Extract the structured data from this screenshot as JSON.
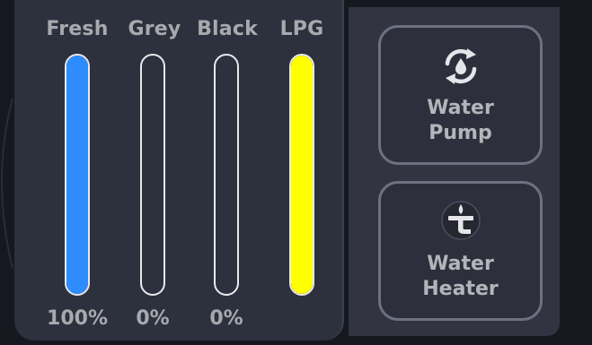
{
  "tanks": [
    {
      "label": "Fresh",
      "percent_text": "100%",
      "level": 1.0,
      "fill_color": "#2e8cff"
    },
    {
      "label": "Grey",
      "percent_text": "0%",
      "level": 0.0,
      "fill_color": "#2e8cff"
    },
    {
      "label": "Black",
      "percent_text": "0%",
      "level": 0.0,
      "fill_color": "#2e8cff"
    },
    {
      "label": "LPG",
      "percent_text": "",
      "level": 1.0,
      "fill_color": "#ffff00"
    }
  ],
  "controls": {
    "water_pump": {
      "line1": "Water",
      "line2": "Pump",
      "icon": "water-recycle-icon"
    },
    "water_heater": {
      "line1": "Water",
      "line2": "Heater",
      "icon": "heater-logo-icon"
    }
  },
  "colors": {
    "panel": "#2d303d",
    "text": "#a8a9ae",
    "tube_border": "#e9e9ec",
    "fresh": "#2e8cff",
    "lpg": "#ffff00"
  }
}
